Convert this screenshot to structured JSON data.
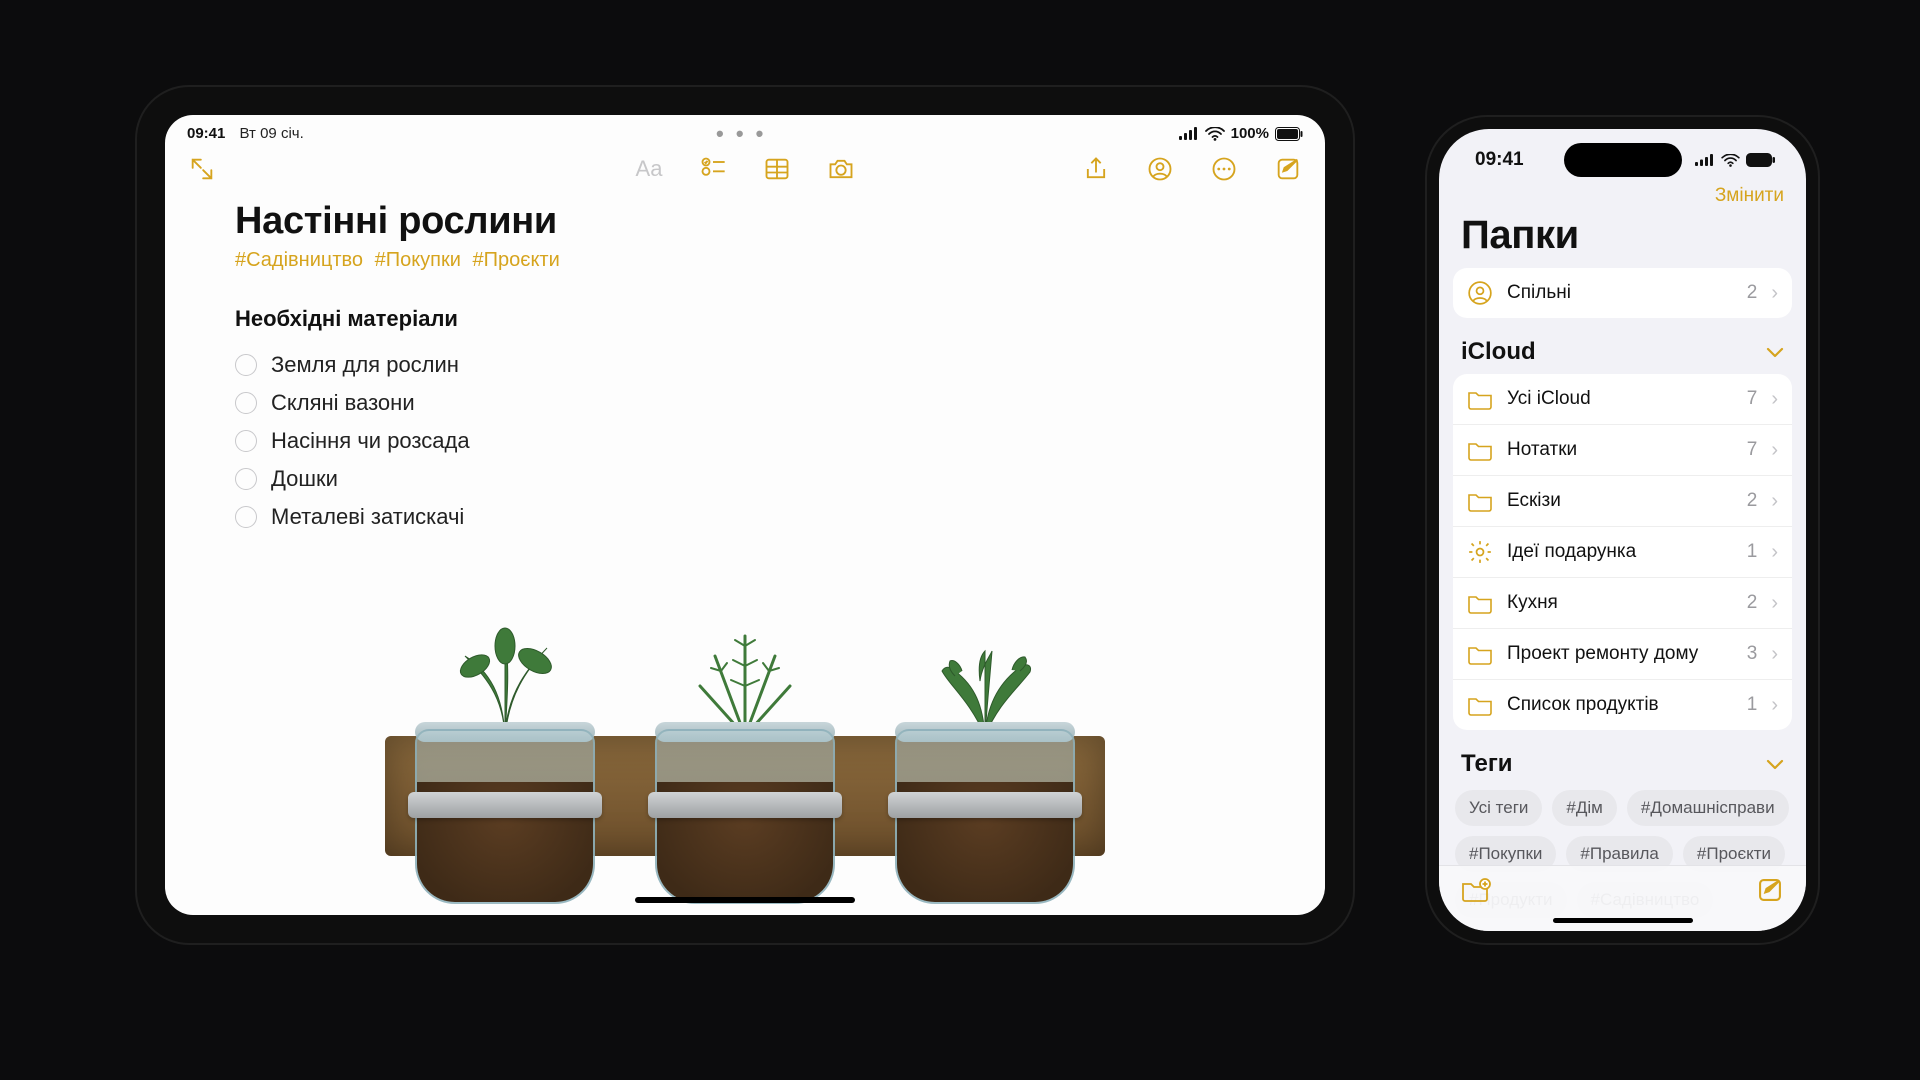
{
  "ipad": {
    "status": {
      "time": "09:41",
      "date": "Вт 09 січ.",
      "battery": "100%"
    },
    "toolbar_icons": {
      "collapse": "collapse-icon",
      "aa": "Aa",
      "checklist": "checklist-icon",
      "table": "table-icon",
      "camera": "camera-icon",
      "share": "share-icon",
      "people": "people-icon",
      "more": "more-icon",
      "compose": "compose-icon"
    },
    "note": {
      "title": "Настінні рослини",
      "tags": [
        "#Садівництво",
        "#Покупки",
        "#Проєкти"
      ],
      "section": "Необхідні матеріали",
      "items": [
        "Земля для рослин",
        "Скляні вазони",
        "Насіння чи розсада",
        "Дошки",
        "Металеві затискачі"
      ]
    }
  },
  "iphone": {
    "status": {
      "time": "09:41"
    },
    "nav_edit": "Змінити",
    "title": "Папки",
    "shared": {
      "label": "Спільні",
      "count": "2"
    },
    "icloud_header": "iCloud",
    "folders": [
      {
        "icon": "folder",
        "label": "Усі iCloud",
        "count": "7"
      },
      {
        "icon": "folder",
        "label": "Нотатки",
        "count": "7"
      },
      {
        "icon": "folder",
        "label": "Ескізи",
        "count": "2"
      },
      {
        "icon": "gear",
        "label": "Ідеї подарунка",
        "count": "1"
      },
      {
        "icon": "folder",
        "label": "Кухня",
        "count": "2"
      },
      {
        "icon": "folder",
        "label": "Проект ремонту дому",
        "count": "3"
      },
      {
        "icon": "folder",
        "label": "Список продуктів",
        "count": "1"
      }
    ],
    "tags_header": "Теги",
    "tags": [
      "Усі теги",
      "#Дім",
      "#Домашнісправи",
      "#Покупки",
      "#Правила",
      "#Проєкти",
      "#Продукти",
      "#Садівництво"
    ]
  },
  "colors": {
    "accent": "#d6a41e"
  }
}
